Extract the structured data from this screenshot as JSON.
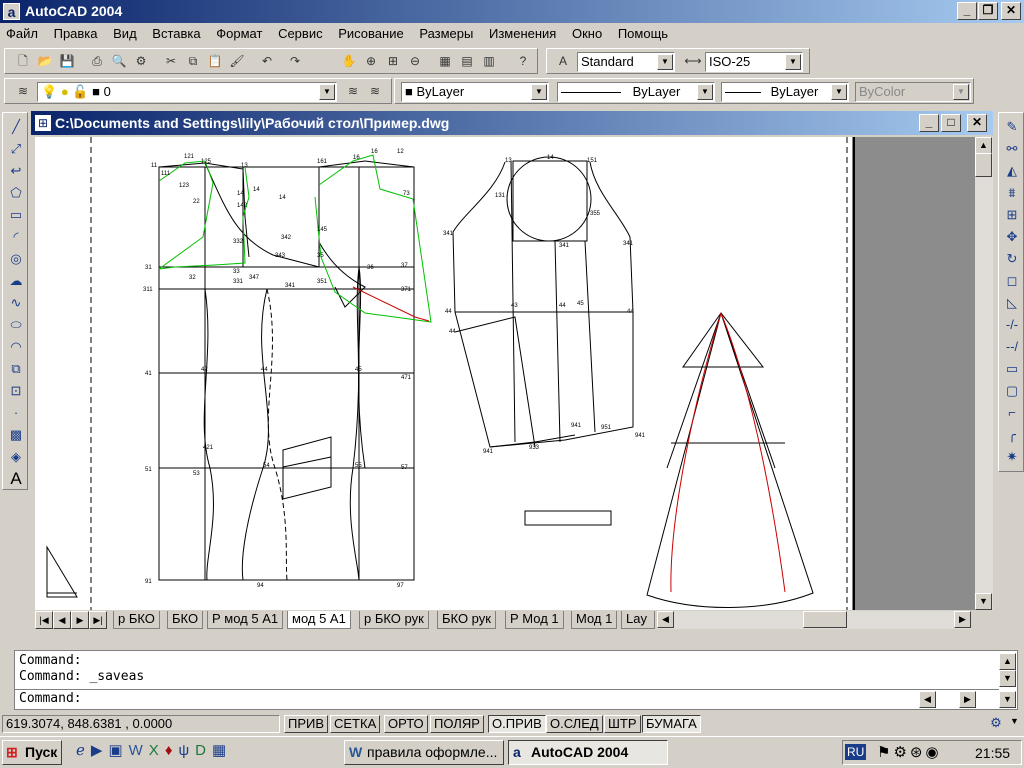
{
  "app": {
    "title": "AutoCAD 2004",
    "icon_letter": "a"
  },
  "menu": [
    "Файл",
    "Правка",
    "Вид",
    "Вставка",
    "Формат",
    "Сервис",
    "Рисование",
    "Размеры",
    "Изменения",
    "Окно",
    "Помощь"
  ],
  "toolbar_standard": {
    "text_style": "Standard",
    "dim_style": "ISO-25"
  },
  "toolbar_layers": {
    "layer_name": "0",
    "color": "ByLayer",
    "linetype": "ByLayer",
    "lineweight": "ByLayer",
    "plotstyle": "ByColor"
  },
  "drawing_window": {
    "title": "C:\\Documents and Settings\\lily\\Рабочий стол\\Пример.dwg"
  },
  "tabs": [
    "р БКО",
    "БКО",
    "Р мод 5 А1",
    "мод 5 А1",
    "р БКО рук",
    "БКО рук",
    "Р Мод 1",
    "Мод 1",
    "Lay"
  ],
  "active_tab": "мод 5 А1",
  "drawing_labels": {
    "l11": "11",
    "l121": "121",
    "l125": "125",
    "l13": "13",
    "l161": "161",
    "l16": "16",
    "l12": "12",
    "l111": "111",
    "l123": "123",
    "l14a": "14",
    "l14b": "14",
    "l142": "142",
    "l14c": "14",
    "l73": "73",
    "l22": "22",
    "l332": "332",
    "l342": "342",
    "l145": "145",
    "l343": "343",
    "l35": "35",
    "l31": "31",
    "l32": "32",
    "l33": "33",
    "l347": "347",
    "l331": "331",
    "l37": "37",
    "l311": "311",
    "l371": "371",
    "l341": "341",
    "l351": "351",
    "l36": "36",
    "l41": "41",
    "l42": "42",
    "l44": "44",
    "l45": "45",
    "l471": "471",
    "l421": "421",
    "l51": "51",
    "l53": "53",
    "l54": "54",
    "l55": "55",
    "l57": "57",
    "l91": "91",
    "l94": "94",
    "l97": "97",
    "s13": "13",
    "s14": "14",
    "s151": "151",
    "s131": "131",
    "s355": "355",
    "s341a": "341",
    "s341b": "341",
    "s341c": "341",
    "s44a": "44",
    "s43": "43",
    "s44b": "44",
    "s45": "45",
    "s44c": "44",
    "s44d": "44",
    "s941a": "941",
    "s951": "951",
    "s941b": "941",
    "s941c": "941",
    "s933": "933"
  },
  "command": {
    "line1": "Command:",
    "line2": "Command:  _saveas",
    "prompt": "Command:"
  },
  "status": {
    "coords": "619.3074, 848.6381 , 0.0000",
    "buttons": [
      {
        "label": "ПРИВ",
        "on": false
      },
      {
        "label": "СЕТКА",
        "on": false
      },
      {
        "label": "ОРТО",
        "on": false
      },
      {
        "label": "ПОЛЯР",
        "on": false
      },
      {
        "label": "О.ПРИВ",
        "on": true
      },
      {
        "label": "О.СЛЕД",
        "on": false
      },
      {
        "label": "ШТР",
        "on": false
      },
      {
        "label": "БУМАГА",
        "on": true
      }
    ]
  },
  "taskbar": {
    "start": "Пуск",
    "tasks": [
      "правила оформле...",
      "AutoCAD 2004"
    ],
    "lang": "RU",
    "clock": "21:55"
  },
  "colors": {
    "titlebar_start": "#0a246a",
    "titlebar_end": "#a6caf0",
    "face": "#d4d0c8",
    "pattern_green": "#00c000",
    "pattern_red": "#cc0000"
  }
}
